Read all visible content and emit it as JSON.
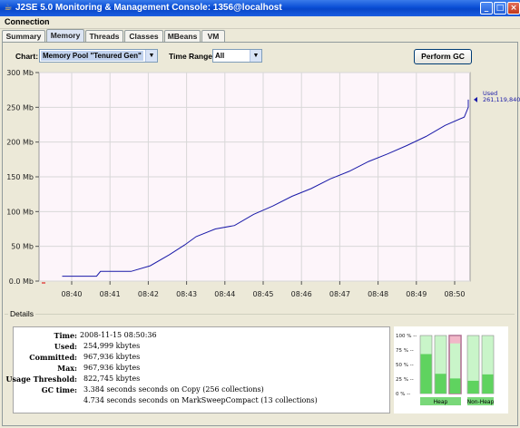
{
  "window": {
    "title": "J2SE 5.0 Monitoring & Management Console: 1356@localhost",
    "minimize_label": "_",
    "maximize_label": "□",
    "close_label": "×"
  },
  "menu": {
    "items": [
      "Connection"
    ]
  },
  "tabs": [
    {
      "label": "Summary",
      "active": false
    },
    {
      "label": "Memory",
      "active": true
    },
    {
      "label": "Threads",
      "active": false
    },
    {
      "label": "Classes",
      "active": false
    },
    {
      "label": "MBeans",
      "active": false
    },
    {
      "label": "VM",
      "active": false
    }
  ],
  "controls": {
    "chart_label": "Chart:",
    "chart_value": "Memory Pool \"Tenured Gen\"",
    "time_range_label": "Time Range:",
    "time_range_value": "All",
    "gc_button": "Perform GC"
  },
  "chart_data": {
    "type": "line",
    "ylabel": "",
    "xlabel": "",
    "ylim": [
      0,
      300
    ],
    "y_ticks": [
      "0.0 Mb",
      "50 Mb",
      "100 Mb",
      "150 Mb",
      "200 Mb",
      "250 Mb",
      "300 Mb"
    ],
    "x_ticks": [
      "08:40",
      "08:41",
      "08:42",
      "08:43",
      "08:44",
      "08:45",
      "08:46",
      "08:47",
      "08:48",
      "08:49",
      "08:50"
    ],
    "grid": true,
    "annotation": {
      "label": "Used",
      "value": "261,119,840"
    },
    "series": [
      {
        "name": "Used",
        "color": "#1a1aa8",
        "x_minutes": [
          0,
          0.9,
          1.0,
          1.8,
          2.3,
          2.8,
          3.2,
          3.5,
          4.0,
          4.5,
          5.0,
          5.5,
          6.0,
          6.5,
          7.0,
          7.5,
          8.0,
          8.5,
          9.0,
          9.5,
          10.0,
          10.5,
          10.9,
          11.0
        ],
        "values": [
          7,
          7,
          14,
          14,
          22,
          38,
          52,
          64,
          75,
          80,
          96,
          108,
          122,
          133,
          147,
          158,
          172,
          183,
          195,
          208,
          224,
          236,
          250,
          261
        ]
      }
    ]
  },
  "details": {
    "title": "Details",
    "rows": [
      {
        "key": "Time:",
        "value": "2008-11-15 08:50:36"
      },
      {
        "key": "Used:",
        "value": "254,999 kbytes"
      },
      {
        "key": "Committed:",
        "value": "967,936 kbytes"
      },
      {
        "key": "Max:",
        "value": "967,936 kbytes"
      },
      {
        "key": "Usage Threshold:",
        "value": "822,745 kbytes"
      },
      {
        "key": "GC time:",
        "value": "3.384  seconds seconds on Copy (256 collections)"
      },
      {
        "key": "",
        "value": "4.734  seconds seconds on MarkSweepCompact (13 collections)"
      }
    ]
  },
  "pool_bars": {
    "y_ticks": [
      "100 % --",
      "75 % --",
      "50 % --",
      "25 % --",
      "0 % --"
    ],
    "groups": [
      {
        "label": "Heap",
        "fills": [
          0.68,
          0.34,
          0.26
        ],
        "highlighted": [
          false,
          false,
          true
        ]
      },
      {
        "label": "Non-Heap",
        "fills": [
          0.22,
          0.33
        ],
        "highlighted": [
          false,
          false
        ]
      }
    ],
    "fill_color": "#5fd35f",
    "empty_color": "#c9f5c9",
    "highlight_color": "#f2b7c8",
    "selected_border": "#b06a90",
    "label_bg": "#79d879"
  }
}
